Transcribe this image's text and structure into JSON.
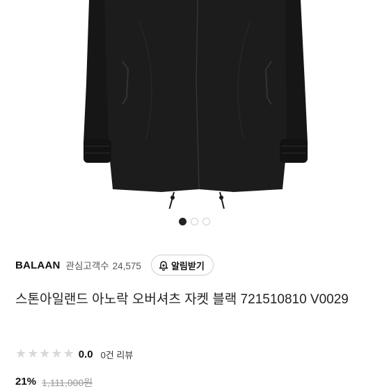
{
  "product": {
    "image_alt": "black anorak overshirt jacket",
    "carousel": {
      "total": 3,
      "active_index": 0
    }
  },
  "seller": {
    "brand": "BALAAN",
    "followers_label": "관심고객수",
    "followers_count": "24,575",
    "notify_label": "알림받기",
    "notify_icon": "bell-plus-icon"
  },
  "title": "스톤아일랜드 아노락 오버셔츠 자켓 블랙 721510810 V0029",
  "rating": {
    "score": "0.0",
    "stars_filled": 0,
    "stars_total": 5,
    "review_count_label": "0건 리뷰"
  },
  "price": {
    "discount_rate": "21%",
    "original_price": "1,111,000원"
  },
  "colors": {
    "star_empty": "#d8d8d8",
    "dot_active": "#222222",
    "dot_inactive": "#cfcfcf"
  }
}
